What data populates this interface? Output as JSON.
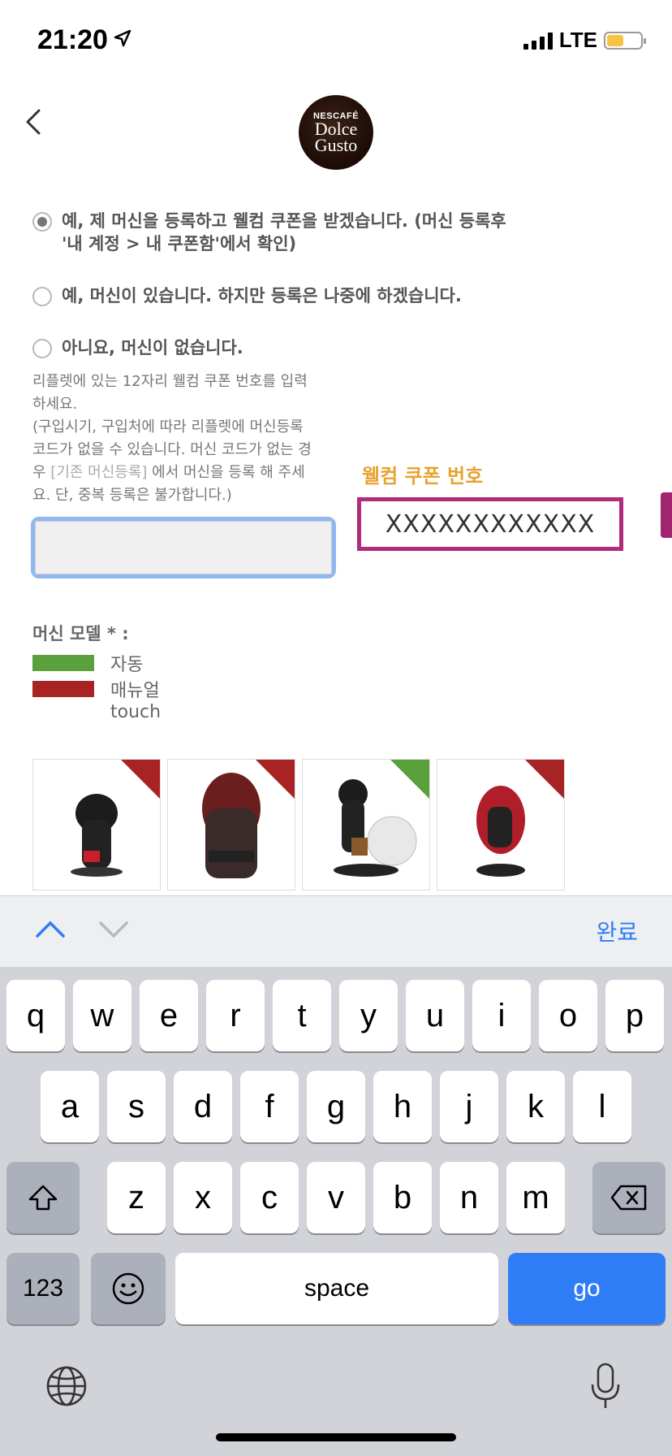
{
  "status_bar": {
    "time": "21:20",
    "network": "LTE"
  },
  "header": {
    "logo_line1": "NESCAFÉ",
    "logo_line2": "Dolce",
    "logo_line3": "Gusto"
  },
  "options": [
    {
      "label": "예, 제 머신을 등록하고 웰컴 쿠폰을 받겠습니다. (머신 등록후",
      "label2": "'내 계정 > 내 쿠폰함'에서 확인)",
      "checked": true
    },
    {
      "label": "예, 머신이 있습니다. 하지만 등록은 나중에 하겠습니다.",
      "checked": false
    },
    {
      "label": "아니요, 머신이 없습니다.",
      "checked": false
    }
  ],
  "instructions": {
    "line1": "리플렛에 있는 12자리 웰컴 쿠폰 번호를 입력",
    "line2": "하세요.",
    "line3": "(구입시기, 구입처에 따라 리플렛에 머신등록",
    "line4": "코드가 없을 수 있습니다. 머신 코드가 없는 경",
    "line5a": "우 ",
    "link": "[기존 머신등록]",
    "line5b": " 에서 머신을 등록 해 주세",
    "line6": "요. 단, 중복 등록은 불가합니다.)"
  },
  "coupon_input": {
    "value": "",
    "placeholder": ""
  },
  "coupon_example": {
    "label": "웰컴 쿠폰 번호",
    "value": "XXXXXXXXXXXX"
  },
  "machine_model": {
    "title": "머신 모델  * :",
    "legend": [
      {
        "label": "자동",
        "color": "#5aa03c"
      },
      {
        "label": "매뉴얼",
        "color": "#a82424"
      },
      {
        "label": "touch",
        "color": ""
      }
    ]
  },
  "machines": [
    {
      "name": "machine-1",
      "corner": "#a82424"
    },
    {
      "name": "machine-2",
      "corner": "#a82424"
    },
    {
      "name": "machine-3",
      "corner": "#5aa03c"
    },
    {
      "name": "machine-4",
      "corner": "#a82424"
    }
  ],
  "accessory_bar": {
    "done": "완료"
  },
  "keyboard": {
    "row1": [
      "q",
      "w",
      "e",
      "r",
      "t",
      "y",
      "u",
      "i",
      "o",
      "p"
    ],
    "row2": [
      "a",
      "s",
      "d",
      "f",
      "g",
      "h",
      "j",
      "k",
      "l"
    ],
    "row3": [
      "z",
      "x",
      "c",
      "v",
      "b",
      "n",
      "m"
    ],
    "numbers": "123",
    "space": "space",
    "go": "go"
  }
}
